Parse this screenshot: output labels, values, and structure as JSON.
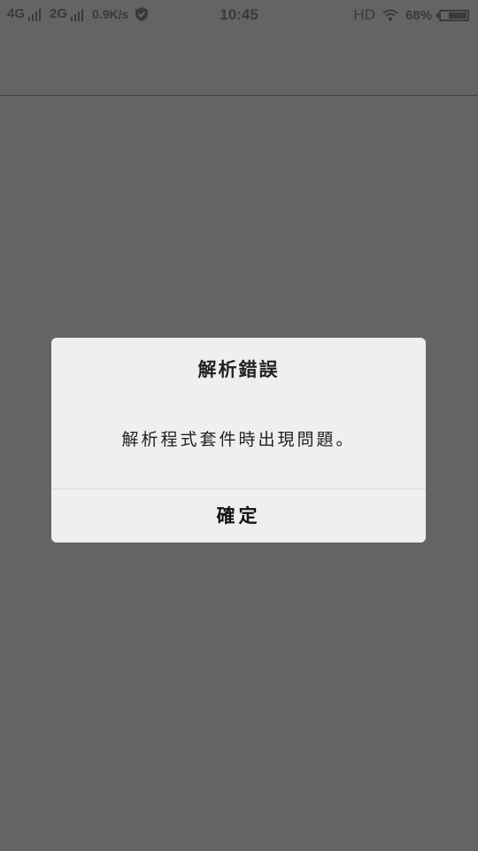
{
  "status_bar": {
    "network_1": "4G",
    "network_2": "2G",
    "speed": "0.9K/s",
    "time": "10:45",
    "hd": "HD",
    "battery_percent": "68%",
    "battery_level": 0.68
  },
  "dialog": {
    "title": "解析錯誤",
    "message": "解析程式套件時出現問題。",
    "ok_label": "確定"
  }
}
